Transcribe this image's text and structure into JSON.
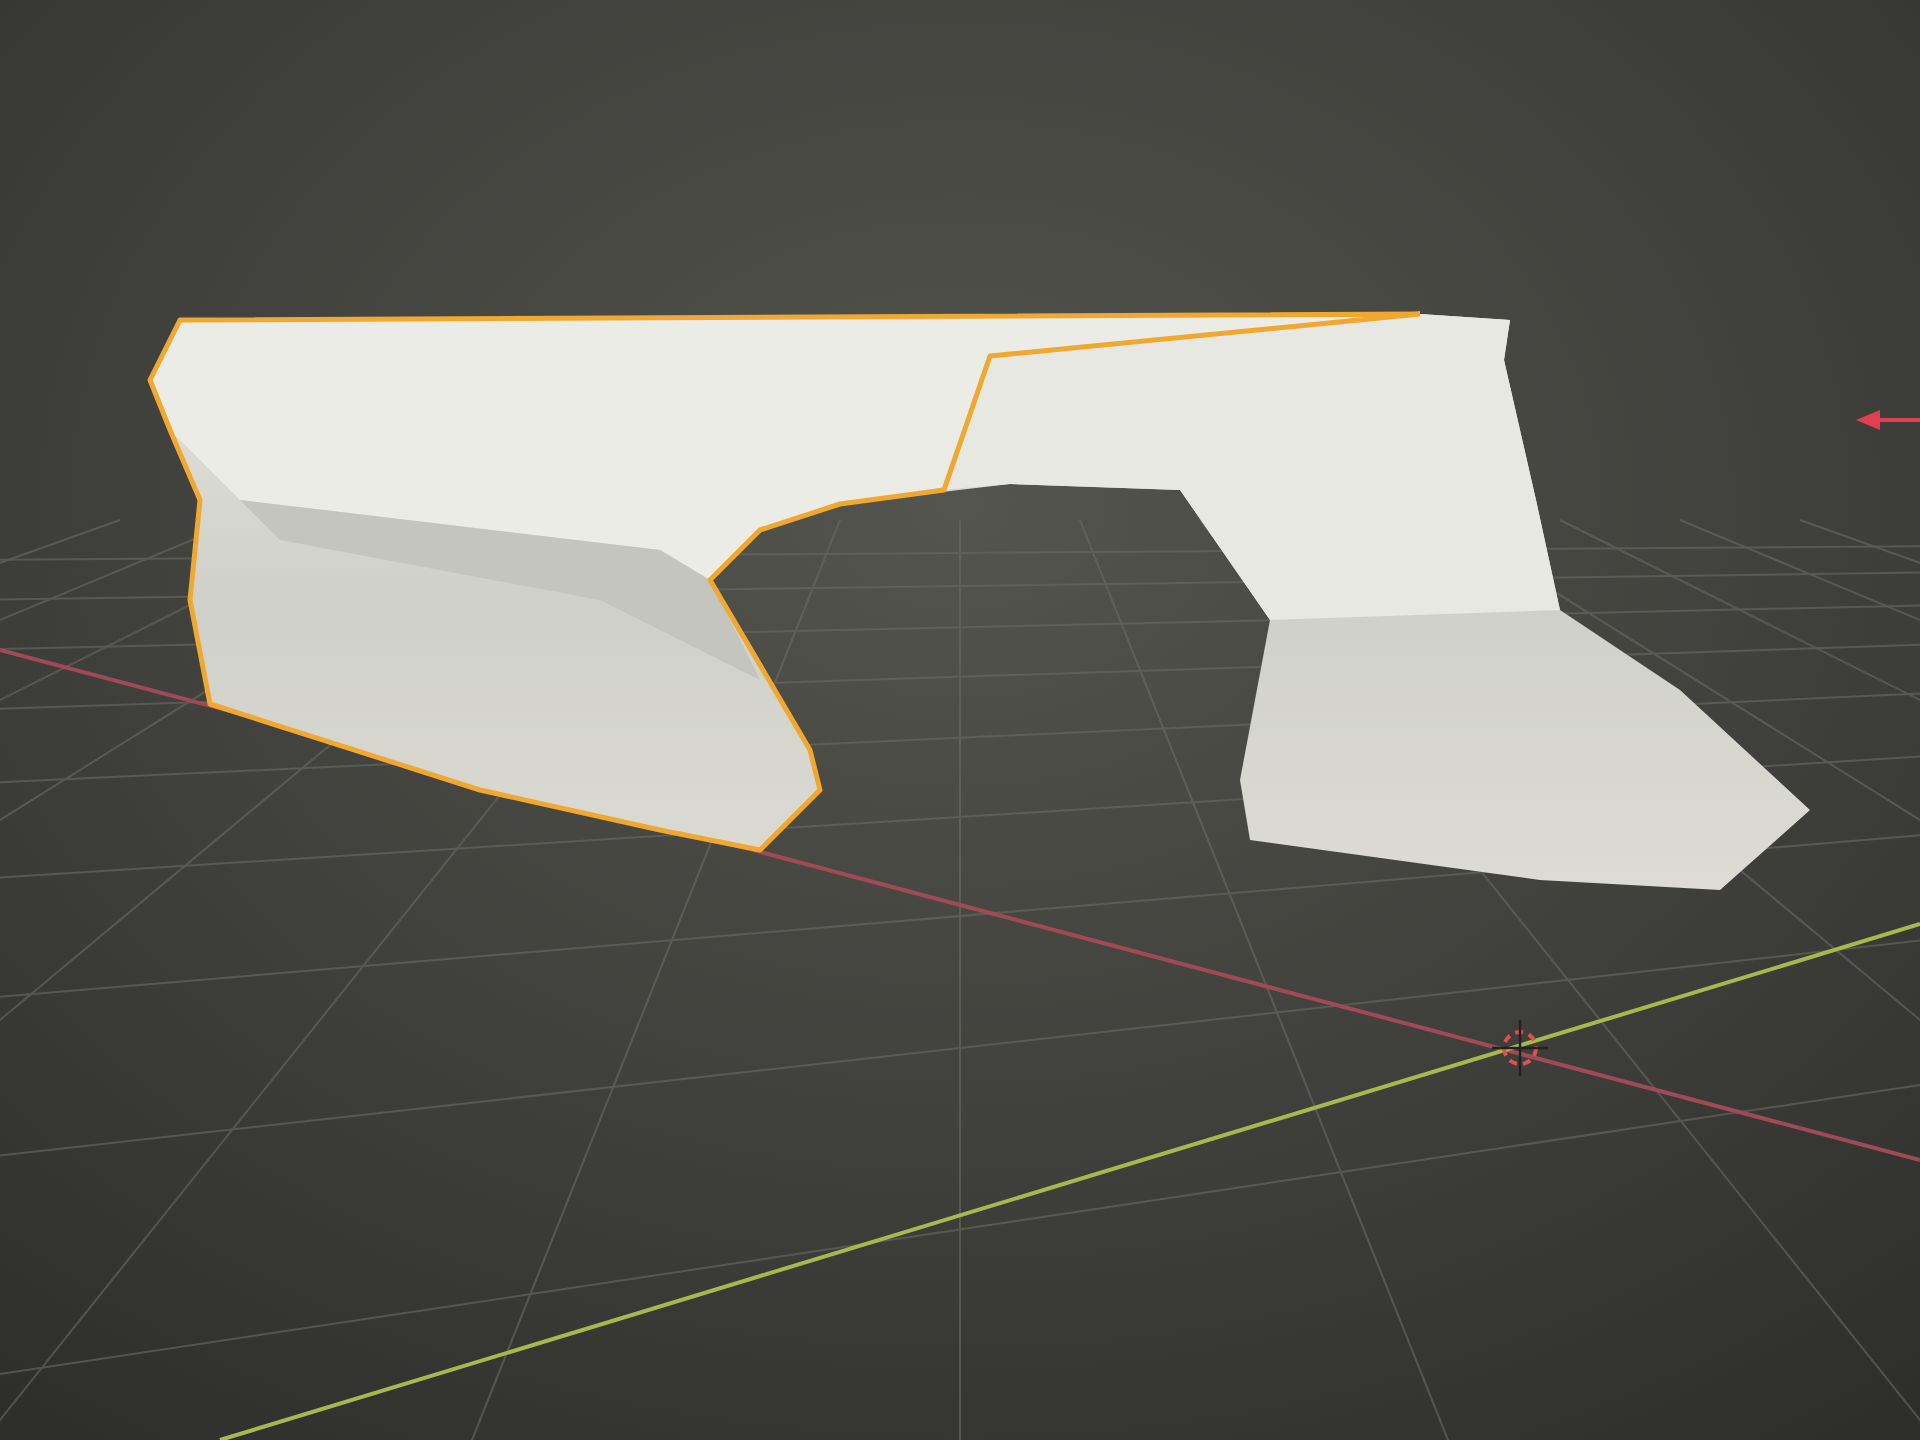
{
  "viewport": {
    "objects": [
      {
        "kind": "mesh",
        "selected": true
      }
    ]
  }
}
